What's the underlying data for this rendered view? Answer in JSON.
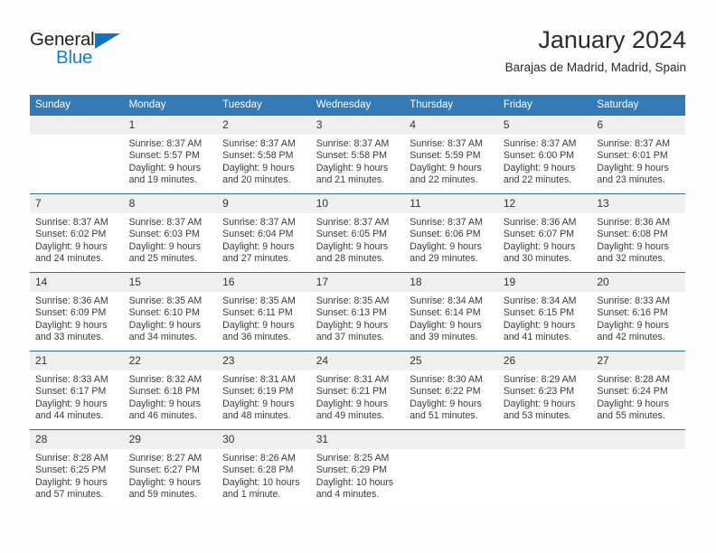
{
  "brand": {
    "name_part1": "General",
    "name_part2": "Blue",
    "triangle_icon": "triangle-icon",
    "accent_color": "#1a7ec4"
  },
  "header": {
    "title": "January 2024",
    "subtitle": "Barajas de Madrid, Madrid, Spain"
  },
  "colors": {
    "header_blue": "#337ab7",
    "row_border_blue": "#2c6da4",
    "daynum_band": "#efefef"
  },
  "weekday_headers": [
    "Sunday",
    "Monday",
    "Tuesday",
    "Wednesday",
    "Thursday",
    "Friday",
    "Saturday"
  ],
  "weeks": [
    [
      {
        "day": "",
        "lines": []
      },
      {
        "day": "1",
        "lines": [
          "Sunrise: 8:37 AM",
          "Sunset: 5:57 PM",
          "Daylight: 9 hours",
          "and 19 minutes."
        ]
      },
      {
        "day": "2",
        "lines": [
          "Sunrise: 8:37 AM",
          "Sunset: 5:58 PM",
          "Daylight: 9 hours",
          "and 20 minutes."
        ]
      },
      {
        "day": "3",
        "lines": [
          "Sunrise: 8:37 AM",
          "Sunset: 5:58 PM",
          "Daylight: 9 hours",
          "and 21 minutes."
        ]
      },
      {
        "day": "4",
        "lines": [
          "Sunrise: 8:37 AM",
          "Sunset: 5:59 PM",
          "Daylight: 9 hours",
          "and 22 minutes."
        ]
      },
      {
        "day": "5",
        "lines": [
          "Sunrise: 8:37 AM",
          "Sunset: 6:00 PM",
          "Daylight: 9 hours",
          "and 22 minutes."
        ]
      },
      {
        "day": "6",
        "lines": [
          "Sunrise: 8:37 AM",
          "Sunset: 6:01 PM",
          "Daylight: 9 hours",
          "and 23 minutes."
        ]
      }
    ],
    [
      {
        "day": "7",
        "lines": [
          "Sunrise: 8:37 AM",
          "Sunset: 6:02 PM",
          "Daylight: 9 hours",
          "and 24 minutes."
        ]
      },
      {
        "day": "8",
        "lines": [
          "Sunrise: 8:37 AM",
          "Sunset: 6:03 PM",
          "Daylight: 9 hours",
          "and 25 minutes."
        ]
      },
      {
        "day": "9",
        "lines": [
          "Sunrise: 8:37 AM",
          "Sunset: 6:04 PM",
          "Daylight: 9 hours",
          "and 27 minutes."
        ]
      },
      {
        "day": "10",
        "lines": [
          "Sunrise: 8:37 AM",
          "Sunset: 6:05 PM",
          "Daylight: 9 hours",
          "and 28 minutes."
        ]
      },
      {
        "day": "11",
        "lines": [
          "Sunrise: 8:37 AM",
          "Sunset: 6:06 PM",
          "Daylight: 9 hours",
          "and 29 minutes."
        ]
      },
      {
        "day": "12",
        "lines": [
          "Sunrise: 8:36 AM",
          "Sunset: 6:07 PM",
          "Daylight: 9 hours",
          "and 30 minutes."
        ]
      },
      {
        "day": "13",
        "lines": [
          "Sunrise: 8:36 AM",
          "Sunset: 6:08 PM",
          "Daylight: 9 hours",
          "and 32 minutes."
        ]
      }
    ],
    [
      {
        "day": "14",
        "lines": [
          "Sunrise: 8:36 AM",
          "Sunset: 6:09 PM",
          "Daylight: 9 hours",
          "and 33 minutes."
        ]
      },
      {
        "day": "15",
        "lines": [
          "Sunrise: 8:35 AM",
          "Sunset: 6:10 PM",
          "Daylight: 9 hours",
          "and 34 minutes."
        ]
      },
      {
        "day": "16",
        "lines": [
          "Sunrise: 8:35 AM",
          "Sunset: 6:11 PM",
          "Daylight: 9 hours",
          "and 36 minutes."
        ]
      },
      {
        "day": "17",
        "lines": [
          "Sunrise: 8:35 AM",
          "Sunset: 6:13 PM",
          "Daylight: 9 hours",
          "and 37 minutes."
        ]
      },
      {
        "day": "18",
        "lines": [
          "Sunrise: 8:34 AM",
          "Sunset: 6:14 PM",
          "Daylight: 9 hours",
          "and 39 minutes."
        ]
      },
      {
        "day": "19",
        "lines": [
          "Sunrise: 8:34 AM",
          "Sunset: 6:15 PM",
          "Daylight: 9 hours",
          "and 41 minutes."
        ]
      },
      {
        "day": "20",
        "lines": [
          "Sunrise: 8:33 AM",
          "Sunset: 6:16 PM",
          "Daylight: 9 hours",
          "and 42 minutes."
        ]
      }
    ],
    [
      {
        "day": "21",
        "lines": [
          "Sunrise: 8:33 AM",
          "Sunset: 6:17 PM",
          "Daylight: 9 hours",
          "and 44 minutes."
        ]
      },
      {
        "day": "22",
        "lines": [
          "Sunrise: 8:32 AM",
          "Sunset: 6:18 PM",
          "Daylight: 9 hours",
          "and 46 minutes."
        ]
      },
      {
        "day": "23",
        "lines": [
          "Sunrise: 8:31 AM",
          "Sunset: 6:19 PM",
          "Daylight: 9 hours",
          "and 48 minutes."
        ]
      },
      {
        "day": "24",
        "lines": [
          "Sunrise: 8:31 AM",
          "Sunset: 6:21 PM",
          "Daylight: 9 hours",
          "and 49 minutes."
        ]
      },
      {
        "day": "25",
        "lines": [
          "Sunrise: 8:30 AM",
          "Sunset: 6:22 PM",
          "Daylight: 9 hours",
          "and 51 minutes."
        ]
      },
      {
        "day": "26",
        "lines": [
          "Sunrise: 8:29 AM",
          "Sunset: 6:23 PM",
          "Daylight: 9 hours",
          "and 53 minutes."
        ]
      },
      {
        "day": "27",
        "lines": [
          "Sunrise: 8:28 AM",
          "Sunset: 6:24 PM",
          "Daylight: 9 hours",
          "and 55 minutes."
        ]
      }
    ],
    [
      {
        "day": "28",
        "lines": [
          "Sunrise: 8:28 AM",
          "Sunset: 6:25 PM",
          "Daylight: 9 hours",
          "and 57 minutes."
        ]
      },
      {
        "day": "29",
        "lines": [
          "Sunrise: 8:27 AM",
          "Sunset: 6:27 PM",
          "Daylight: 9 hours",
          "and 59 minutes."
        ]
      },
      {
        "day": "30",
        "lines": [
          "Sunrise: 8:26 AM",
          "Sunset: 6:28 PM",
          "Daylight: 10 hours",
          "and 1 minute."
        ]
      },
      {
        "day": "31",
        "lines": [
          "Sunrise: 8:25 AM",
          "Sunset: 6:29 PM",
          "Daylight: 10 hours",
          "and 4 minutes."
        ]
      },
      {
        "day": "",
        "lines": []
      },
      {
        "day": "",
        "lines": []
      },
      {
        "day": "",
        "lines": []
      }
    ]
  ]
}
